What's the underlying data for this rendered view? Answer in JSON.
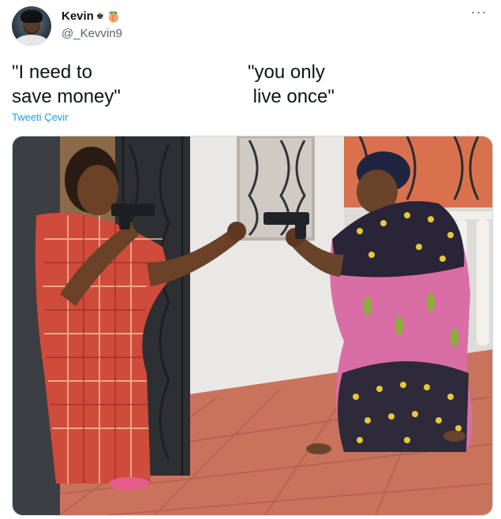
{
  "author": {
    "display_name": "Kevin",
    "name_suffix": "♚",
    "handle": "@_Kevvin9",
    "emoji": "peach-emoji"
  },
  "tweet": {
    "left_text": "\"I need to\nsave money\"",
    "right_text": "\"you only\n live once\"",
    "translate_label": "Tweeti Çevir"
  },
  "more_menu": {
    "icon": "more-horizontal-icon",
    "label": "···"
  },
  "colors": {
    "link": "#1d9bf0",
    "secondary_text": "#536471",
    "primary_text": "#0f1419"
  },
  "media": {
    "icon": "photo-image",
    "subject": "meme-image-two-women-pointing-guns"
  }
}
